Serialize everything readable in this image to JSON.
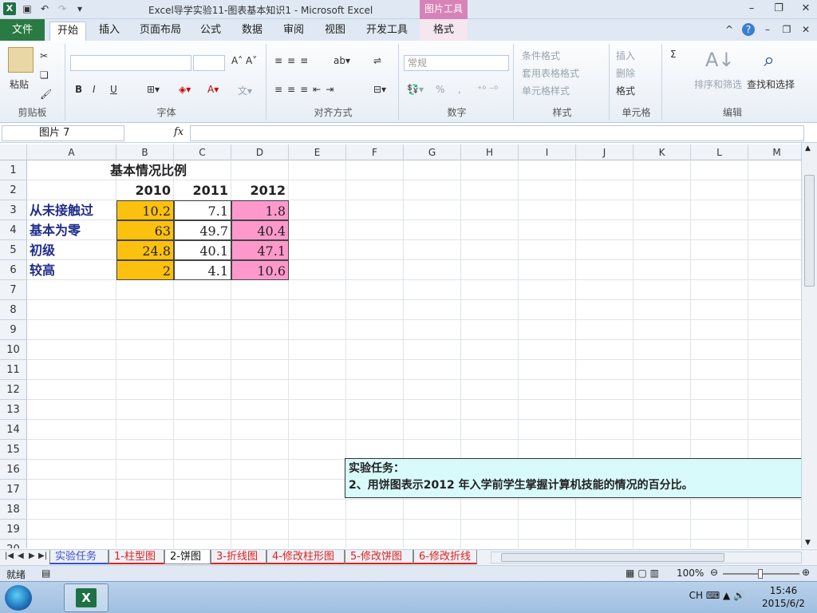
{
  "window": {
    "title": "Excel导学实验11-图表基本知识1 - Microsoft Excel",
    "context_tab_group": "图片工具"
  },
  "ribbon_tabs": [
    "文件",
    "开始",
    "插入",
    "页面布局",
    "公式",
    "数据",
    "审阅",
    "视图",
    "开发工具",
    "格式"
  ],
  "ribbon": {
    "clipboard": {
      "paste": "粘贴",
      "label": "剪贴板"
    },
    "font": {
      "label": "字体",
      "bold": "B",
      "italic": "I",
      "underline": "U"
    },
    "alignment": {
      "label": "对齐方式"
    },
    "number": {
      "format": "常规",
      "label": "数字",
      "percent": "%",
      "comma": ","
    },
    "styles": {
      "conditional": "条件格式",
      "table": "套用表格格式",
      "cell": "单元格样式",
      "label": "样式"
    },
    "cells": {
      "insert": "插入",
      "delete": "删除",
      "format": "格式",
      "label": "单元格"
    },
    "editing": {
      "sort": "排序和筛选",
      "find": "查找和选择",
      "label": "编辑",
      "sum": "Σ"
    }
  },
  "formula_bar": {
    "name_box": "图片 7",
    "fx": "fx",
    "formula": ""
  },
  "columns": [
    "A",
    "B",
    "C",
    "D",
    "E",
    "F",
    "G",
    "H",
    "I",
    "J",
    "K",
    "L",
    "M"
  ],
  "rows": [
    "1",
    "2",
    "3",
    "4",
    "5",
    "6",
    "7",
    "8",
    "9",
    "10",
    "11",
    "12",
    "13",
    "14",
    "15",
    "16",
    "17",
    "18",
    "19",
    "20"
  ],
  "sheet": {
    "title": "基本情况比例",
    "years": [
      "2010",
      "2011",
      "2012"
    ],
    "data_rows": [
      {
        "label": "从未接触过",
        "values": [
          "10.2",
          "7.1",
          "1.8"
        ]
      },
      {
        "label": "基本为零",
        "values": [
          "63",
          "49.7",
          "40.4"
        ]
      },
      {
        "label": "初级",
        "values": [
          "24.8",
          "40.1",
          "47.1"
        ]
      },
      {
        "label": "较高",
        "values": [
          "2",
          "4.1",
          "10.6"
        ]
      }
    ],
    "colors": {
      "col_2010": "#fcc10f",
      "col_2011": "#ffffff",
      "col_2012": "#ff99cc"
    },
    "note_line1": "实验任务：",
    "note_line2": "2、用饼图表示2012 年入学前学生掌握计算机技能的情况的百分比。"
  },
  "sheet_tabs": [
    {
      "name": "实验任务",
      "color": "#3a4fd6"
    },
    {
      "name": "1-柱型图",
      "color": "#e02020"
    },
    {
      "name": "2-饼图",
      "color": "#ffffff"
    },
    {
      "name": "3-折线图",
      "color": "#e02020"
    },
    {
      "name": "4-修改柱形图",
      "color": "#e02020"
    },
    {
      "name": "5-修改饼图",
      "color": "#e02020"
    },
    {
      "name": "6-修改折线",
      "color": "#e02020"
    }
  ],
  "status": {
    "ready": "就绪",
    "zoom": "100%"
  },
  "taskbar": {
    "lang": "CH",
    "time": "15:46",
    "date": "2015/6/2"
  }
}
